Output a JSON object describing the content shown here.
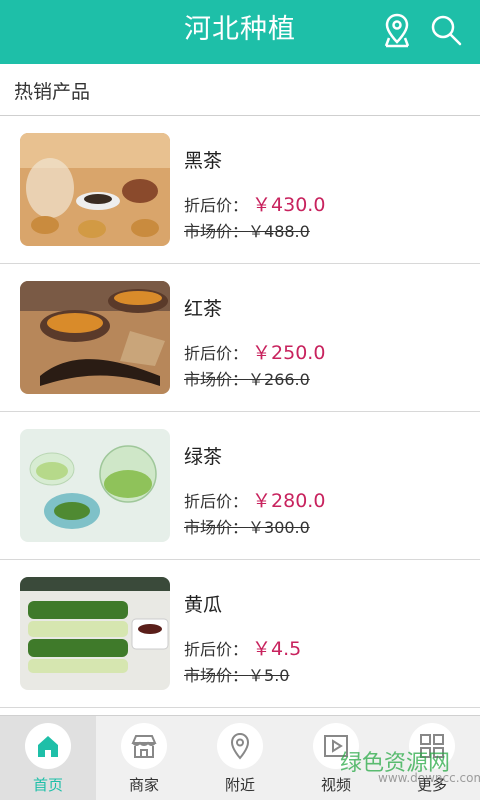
{
  "header": {
    "title": "河北种植",
    "icons": [
      "location-icon",
      "search-icon"
    ],
    "bg_color": "#1ebfa8"
  },
  "section": {
    "title": "热销产品"
  },
  "products": [
    {
      "name": "黑茶",
      "price_label": "折后价：",
      "price": "￥430.0",
      "market_label": "市场价：",
      "market_price": "￥488.0"
    },
    {
      "name": "红茶",
      "price_label": "折后价：",
      "price": "￥250.0",
      "market_label": "市场价：",
      "market_price": "￥266.0"
    },
    {
      "name": "绿茶",
      "price_label": "折后价：",
      "price": "￥280.0",
      "market_label": "市场价：",
      "market_price": "￥300.0"
    },
    {
      "name": "黄瓜",
      "price_label": "折后价：",
      "price": "￥4.5",
      "market_label": "市场价：",
      "market_price": "￥5.0"
    }
  ],
  "nav": {
    "items": [
      {
        "label": "首页",
        "icon": "home-icon",
        "active": true
      },
      {
        "label": "商家",
        "icon": "shop-icon",
        "active": false
      },
      {
        "label": "附近",
        "icon": "location-icon",
        "active": false
      },
      {
        "label": "视频",
        "icon": "video-icon",
        "active": false
      },
      {
        "label": "更多",
        "icon": "grid-icon",
        "active": false
      }
    ]
  },
  "watermark": {
    "text": "绿色资源网",
    "url": "www.downcc.com"
  },
  "colors": {
    "accent": "#1ebfa8",
    "price": "#c8235e"
  }
}
